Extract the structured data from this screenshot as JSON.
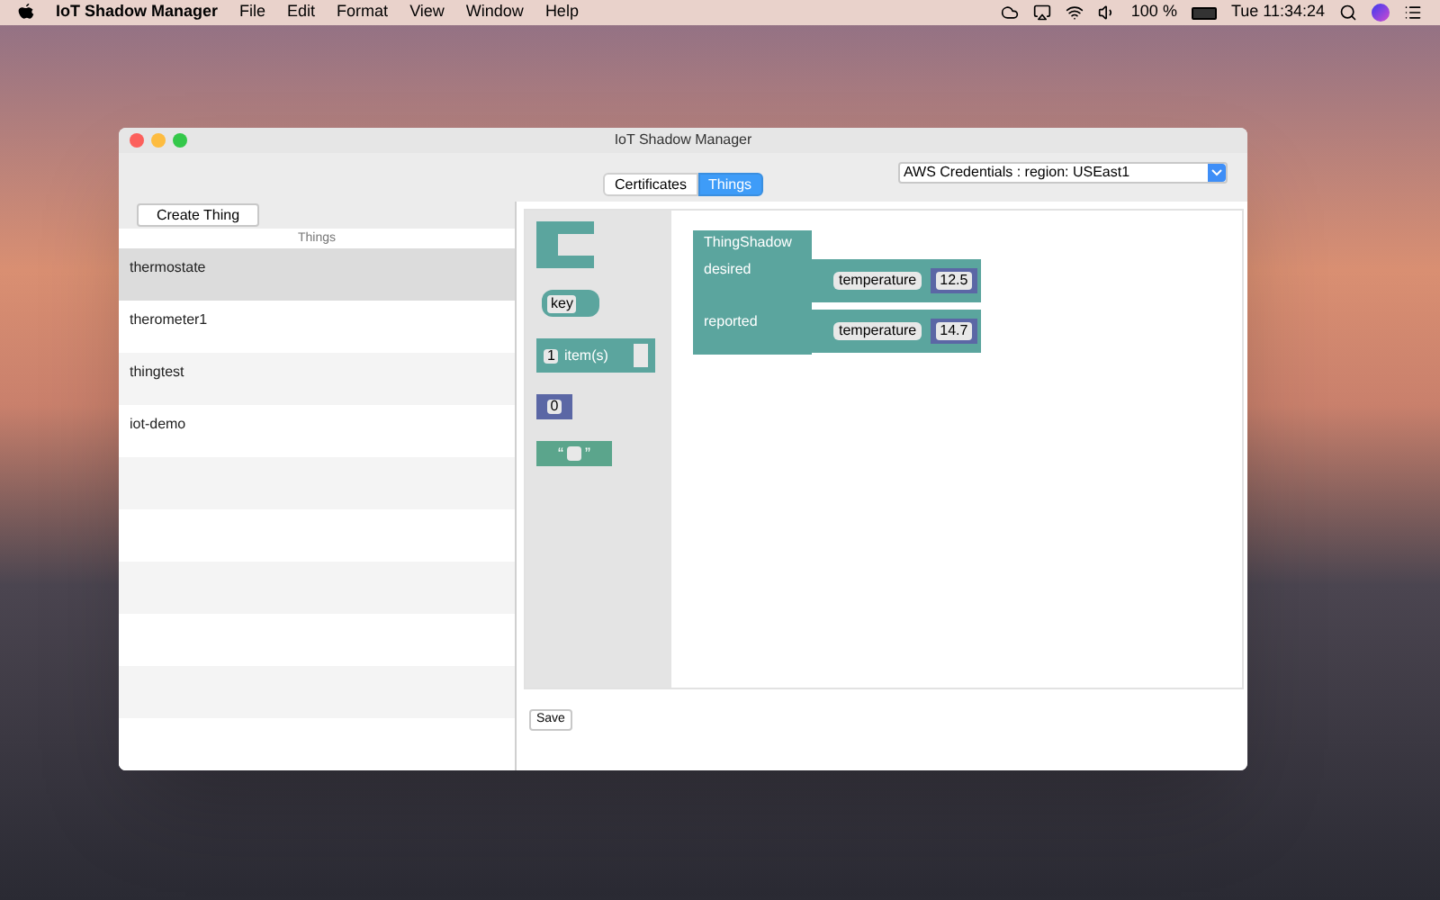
{
  "menu_bar": {
    "app_name": "IoT Shadow Manager",
    "menus": [
      "File",
      "Edit",
      "Format",
      "View",
      "Window",
      "Help"
    ],
    "battery": "100 %",
    "clock": "Tue 11:34:24"
  },
  "window": {
    "title": "IoT Shadow Manager"
  },
  "tabs": [
    {
      "label": "Certificates",
      "selected": false
    },
    {
      "label": "Things",
      "selected": true
    }
  ],
  "credentials_dropdown": {
    "value": "AWS Credentials : region: USEast1"
  },
  "sidebar": {
    "create_button": "Create Thing",
    "header": "Things",
    "items": [
      {
        "name": "thermostate",
        "selected": true
      },
      {
        "name": "therometer1",
        "selected": false
      },
      {
        "name": "thingtest",
        "selected": false
      },
      {
        "name": "iot-demo",
        "selected": false
      }
    ]
  },
  "toolbox": {
    "blocks": [
      {
        "kind": "object"
      },
      {
        "kind": "key",
        "label": "key"
      },
      {
        "kind": "list",
        "count": "1",
        "label": "item(s)"
      },
      {
        "kind": "number",
        "value": "0"
      },
      {
        "kind": "string",
        "open_quote": "“",
        "close_quote": "”"
      }
    ]
  },
  "canvas": {
    "block_title": "ThingShadow",
    "fields": [
      {
        "label": "desired",
        "key": "temperature",
        "value": "12.5"
      },
      {
        "label": "reported",
        "key": "temperature",
        "value": "14.7"
      }
    ]
  },
  "save_button": "Save"
}
